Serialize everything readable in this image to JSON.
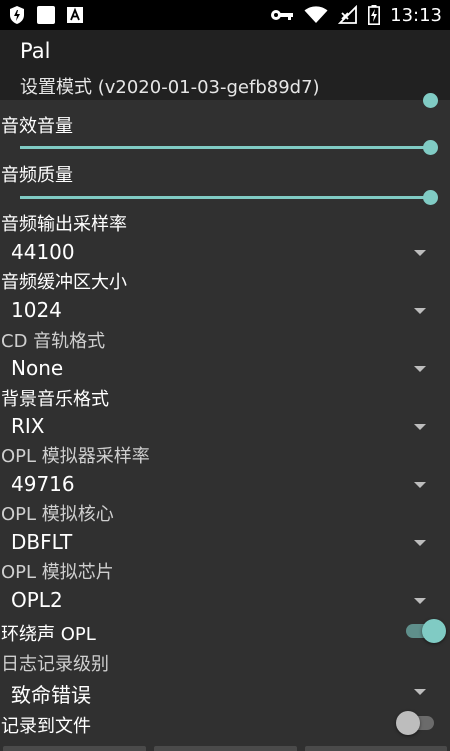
{
  "status_bar": {
    "time": "13:13",
    "left_icons": [
      "shield-icon",
      "square-icon",
      "font-icon"
    ],
    "right_icons": [
      "key-icon",
      "wifi-icon",
      "signal-off-icon",
      "battery-charging-icon"
    ]
  },
  "app_bar": {
    "title": "Pal",
    "subtitle": "设置模式 (v2020-01-03-gefb89d7)"
  },
  "settings": {
    "audio_volume": {
      "label": "音效音量",
      "value": 1.0
    },
    "audio_quality": {
      "label": "音频质量",
      "value": 1.0
    },
    "output_sample_rate": {
      "label": "音频输出采样率",
      "value": "44100"
    },
    "buffer_size": {
      "label": "音频缓冲区大小",
      "value": "1024"
    },
    "cd_track_format": {
      "label": "CD 音轨格式",
      "value": "None"
    },
    "bgm_format": {
      "label": "背景音乐格式",
      "value": "RIX"
    },
    "opl_sample_rate": {
      "label": "OPL 模拟器采样率",
      "value": "49716"
    },
    "opl_core": {
      "label": "OPL 模拟核心",
      "value": "DBFLT"
    },
    "opl_chip": {
      "label": "OPL 模拟芯片",
      "value": "OPL2"
    },
    "surround_opl": {
      "label": "环绕声 OPL",
      "enabled": true
    },
    "log_level": {
      "label": "日志记录级别",
      "value": "致命错误"
    },
    "log_to_file": {
      "label": "记录到文件",
      "enabled": false
    }
  },
  "colors": {
    "accent": "#80cbc4",
    "background": "#303030",
    "app_bar": "#212121",
    "status_bar": "#000000"
  }
}
